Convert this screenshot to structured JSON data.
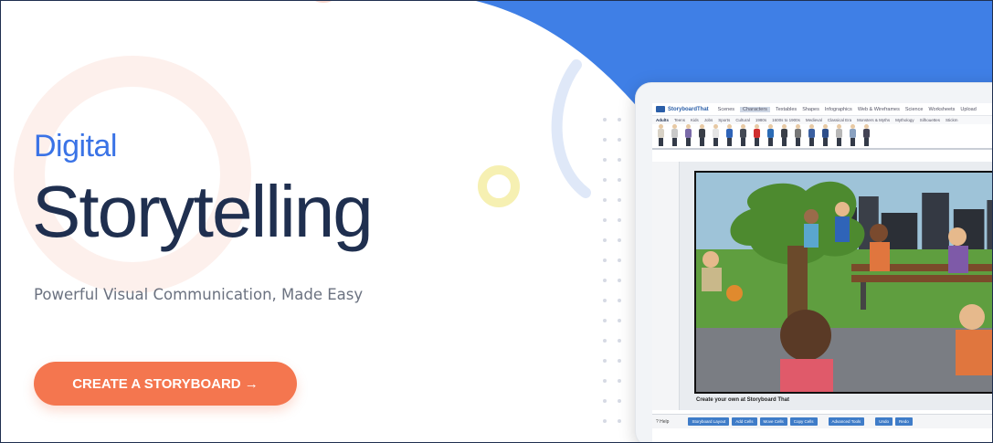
{
  "hero": {
    "eyebrow": "Digital",
    "title": "Storytelling",
    "subtitle": "Powerful Visual Communication, Made Easy",
    "cta_label": "CREATE A STORYBOARD →"
  },
  "colors": {
    "accent_blue": "#3a73e6",
    "title_navy": "#1f2f4f",
    "cta_orange": "#f4764f",
    "bg_blue_shape": "#3f7fe6"
  },
  "app_preview": {
    "logo": "StoryboardThat",
    "tabs": [
      "Scenes",
      "Characters",
      "Textables",
      "Shapes",
      "Infographics",
      "Web & Wireframes",
      "Science",
      "Worksheets",
      "Upload"
    ],
    "active_tab": "Characters",
    "categories": [
      "Adults",
      "Teens",
      "Kids",
      "Jobs",
      "Sports",
      "Cultural",
      "1980s",
      "1600s to 1900s",
      "Medieval",
      "Classical Era",
      "Monsters & Myths",
      "Mythology",
      "Silhouettes",
      "Stickm"
    ],
    "active_category": "Adults",
    "caption": "Create your own at Storyboard That",
    "help_label": "? Help",
    "buttons": [
      "Storyboard Layout",
      "Add Cells",
      "Move Cells",
      "Copy Cells",
      "Advanced Tools",
      "Undo",
      "Redo"
    ]
  }
}
